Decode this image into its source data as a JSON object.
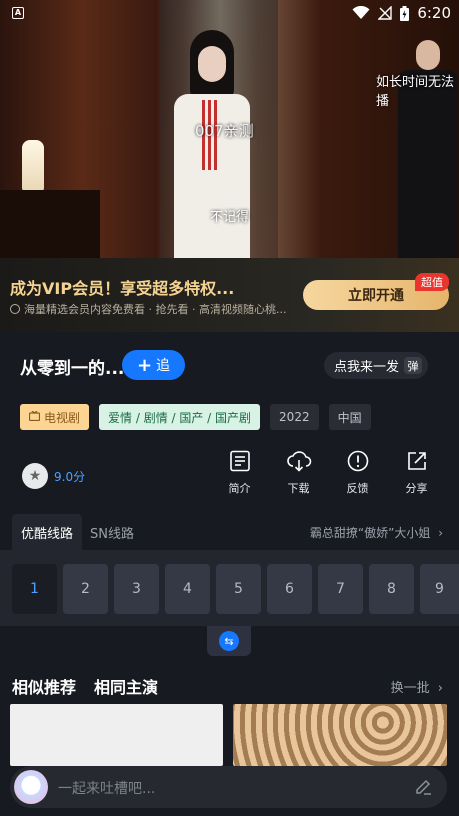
{
  "status_bar": {
    "time": "6:20",
    "app_indicator": "A"
  },
  "video": {
    "subtitles": [
      "如长时间无法播",
      "007亲测",
      "不记得"
    ]
  },
  "vip_banner": {
    "title": "成为VIP会员！享受超多特权...",
    "subtitle": "海量精选会员内容免费看 · 抢先看 · 高清视频随心桃...",
    "button": "立即开通",
    "badge": "超值"
  },
  "show": {
    "title": "从零到一的...",
    "follow_label": "追",
    "danmu_label": "点我来一发",
    "danmu_icon_text": "弹",
    "tags": [
      "电视剧",
      "爱情 / 剧情 / 国产 / 国产剧",
      "2022",
      "中国"
    ],
    "rating": "9.0分"
  },
  "actions": [
    {
      "label": "简介",
      "icon": "info-list-icon"
    },
    {
      "label": "下载",
      "icon": "cloud-download-icon"
    },
    {
      "label": "反馈",
      "icon": "alert-icon"
    },
    {
      "label": "分享",
      "icon": "share-icon"
    }
  ],
  "routes": {
    "active": "优酷线路",
    "other": "SN线路",
    "episode_desc": "霸总甜撩“傲娇”大小姐"
  },
  "episodes": [
    "1",
    "2",
    "3",
    "4",
    "5",
    "6",
    "7",
    "8",
    "9"
  ],
  "recommend": {
    "tab1": "相似推荐",
    "tab2": "相同主演",
    "more": "换一批"
  },
  "comment": {
    "placeholder": "一起来吐槽吧..."
  },
  "colors": {
    "accent": "#1677ff",
    "vip_gold": "#f5d491",
    "background": "#181a21"
  }
}
